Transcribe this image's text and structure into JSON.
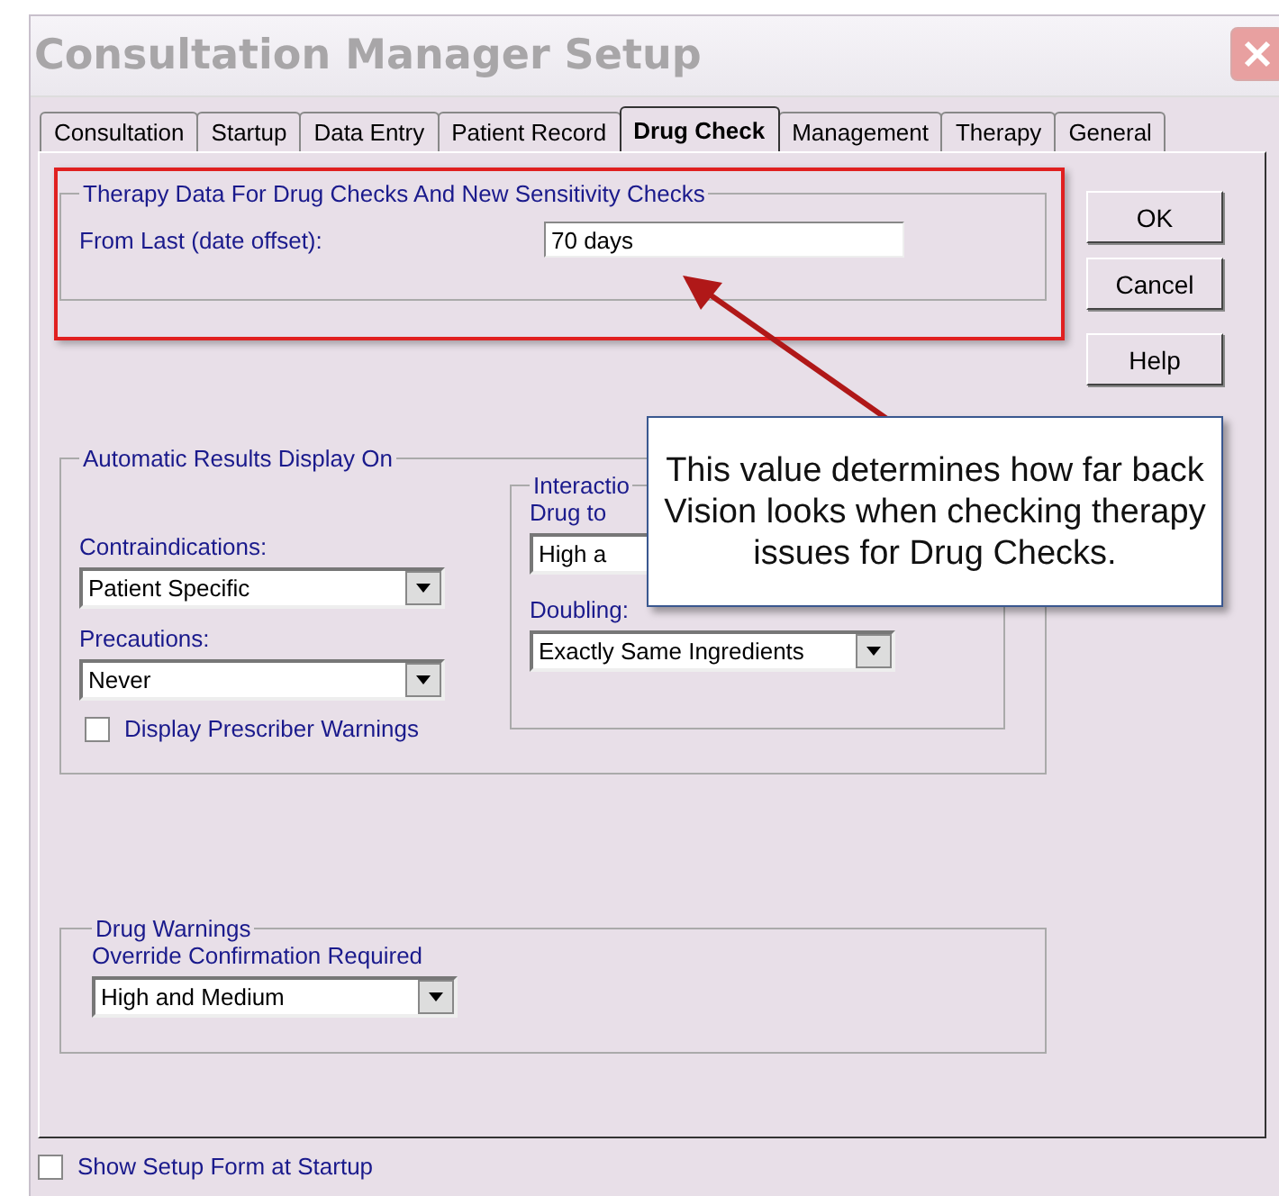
{
  "window": {
    "title": "Consultation Manager Setup"
  },
  "tabs": [
    {
      "label": "Consultation",
      "selected": false
    },
    {
      "label": "Startup",
      "selected": false
    },
    {
      "label": "Data Entry",
      "selected": false
    },
    {
      "label": "Patient Record",
      "selected": false
    },
    {
      "label": "Drug Check",
      "selected": true
    },
    {
      "label": "Management",
      "selected": false
    },
    {
      "label": "Therapy",
      "selected": false
    },
    {
      "label": "General",
      "selected": false
    }
  ],
  "therapy_data": {
    "title": "Therapy Data For Drug Checks And New Sensitivity Checks",
    "label": "From Last (date offset):",
    "value": "70 days"
  },
  "buttons": [
    "OK",
    "Cancel",
    "Help"
  ],
  "automatic_results": {
    "title": "Automatic Results Display On",
    "contraindications": {
      "label": "Contraindications:",
      "value": "Patient Specific"
    },
    "precautions": {
      "label": "Precautions:",
      "value": "Never"
    },
    "prescriber_warnings": {
      "label": "Display Prescriber Warnings",
      "checked": false
    },
    "interactions": {
      "title": "Interactio",
      "drug_to_label": "Drug to",
      "drug_to_value": "High a",
      "doubling": {
        "label": "Doubling:",
        "value": "Exactly Same Ingredients"
      }
    }
  },
  "drug_warnings": {
    "title": "Drug Warnings",
    "label": "Override Confirmation Required",
    "value": "High and Medium"
  },
  "show_setup_form": {
    "label": "Show Setup Form at Startup",
    "checked": false
  },
  "callout": {
    "text": "This value determines how far back Vision looks when checking therapy issues for Drug Checks."
  }
}
